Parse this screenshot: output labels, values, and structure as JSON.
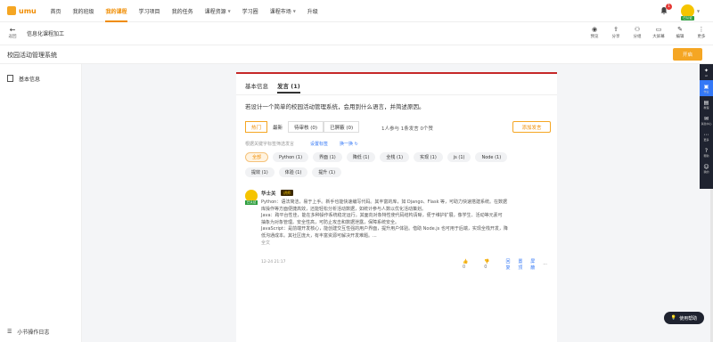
{
  "app": {
    "logo_text": "umu"
  },
  "nav": {
    "home": "首页",
    "my_class": "我的班级",
    "my_course": "我的课程",
    "learn_project": "学习项目",
    "my_task": "我的任务",
    "course_resources": "课程资源",
    "learning_circle": "学习圈",
    "course_market": "课程市场",
    "upgrade": "升级"
  },
  "notifications": {
    "count": "1"
  },
  "user": {
    "badge": "已认证"
  },
  "subbar": {
    "back_label": "返回",
    "breadcrumb": "信息化课程加工",
    "tools": [
      {
        "label": "预览",
        "icon": "eye-icon"
      },
      {
        "label": "分享",
        "icon": "share-icon"
      },
      {
        "label": "分组",
        "icon": "group-icon"
      },
      {
        "label": "大屏幕",
        "icon": "screen-icon"
      },
      {
        "label": "编辑",
        "icon": "edit-icon"
      },
      {
        "label": "更多",
        "icon": "more-icon"
      }
    ]
  },
  "course": {
    "title": "校园活动管理系统",
    "publish_label": "开启"
  },
  "sidebar": {
    "basic_info": "基本信息",
    "section_log": "小节操作日志"
  },
  "tabs": {
    "basic": "基本信息",
    "discussion": "发言 (1)"
  },
  "question": "若设计一个简单的校园活动管理系统，会用到什么语言，并简述原因。",
  "filters": {
    "hot": "热门",
    "latest": "最新",
    "pending": "待审核 (0)",
    "deleted": "已屏蔽 (0)"
  },
  "stats": "1人参与  1条发言  0个赞",
  "post_button": "添加发言",
  "keywords": {
    "hint": "根据关键字标签筛选发言",
    "set": "设置标签",
    "swap": "换一换"
  },
  "chips": [
    "全部",
    "Python (1)",
    "界面 (1)",
    "降低 (1)",
    "全栈 (1)",
    "实现 (1)",
    "js (1)",
    "Node (1)",
    "提效 (1)",
    "体验 (1)",
    "提升 (1)"
  ],
  "post": {
    "author": "华士关",
    "role": "讲师",
    "lines": [
      "Python：语法简洁，易于上手。新手也能快速编写代码。其丰富的库，如 Django、Flask 等，可助力快速搭建系统。在数据",
      "库操作等方面便捷高效，还能轻松分析活动数据，如统计参与人数以优化活动策划。",
      "Java：跨平台性佳，能在多种操作系统稳定运行。其面向对象特性使代码结构清晰，便于维护扩展，像学生、活动等元素可",
      "抽象为对象管理。安全性高，可防止攻击和数据泄露，保障系统安全。",
      "JavaScript：是前端开发核心，能创建交互性强的用户界面，提升用户体验。借助 Node.js 也可用于后端，实现全栈开发，降",
      "低沟通成本。其社区庞大，有丰富资源可解决开发难题。..."
    ],
    "full_text": "全文",
    "time": "12-24 21:17",
    "likes": "0",
    "dislikes": "0",
    "reply": "回复",
    "top": "置顶",
    "hide": "屏蔽",
    "more": "···"
  },
  "rail": [
    {
      "label": "AI",
      "icon": "ai-icon"
    },
    {
      "label": "作业",
      "icon": "task-icon"
    },
    {
      "label": "教程",
      "icon": "book-icon"
    },
    {
      "label": "消息中心",
      "icon": "message-icon"
    },
    {
      "label": "更多",
      "icon": "more-icon"
    },
    {
      "label": "帮助",
      "icon": "help-icon"
    },
    {
      "label": "我的",
      "icon": "user-icon"
    }
  ],
  "help_button": "使用帮助",
  "colors": {
    "accent": "#f5a623",
    "active_nav": "#f08c00",
    "card_top": "#c62828",
    "link": "#3478f6"
  }
}
